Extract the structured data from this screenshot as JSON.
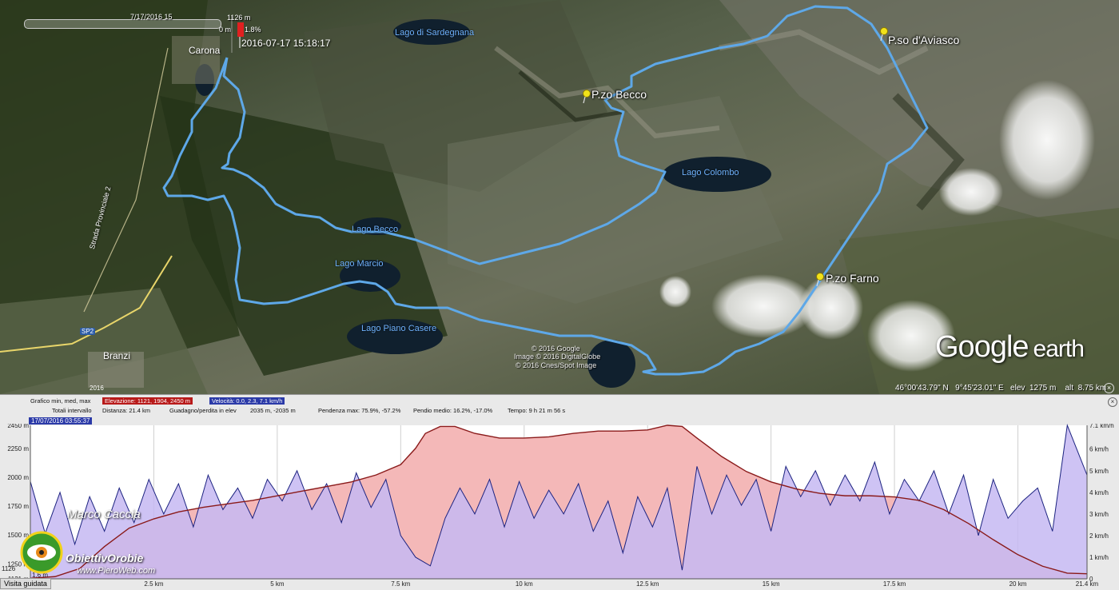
{
  "map": {
    "slider_date": "7/17/2016  15",
    "top_elev": "1126 m",
    "bottom_elev": "0 m",
    "grade": "1.8%",
    "marker_time": "2016-07-17 15:18:17",
    "town_carona": "Carona",
    "town_branzi": "Branzi",
    "road_label": "Strada Provinciale 2",
    "road_sp2": "SP2",
    "lakes": {
      "sardegnana": "Lago di Sardegnana",
      "colombo": "Lago Colombo",
      "becco": "Lago Becco",
      "marcio": "Lago Marcio",
      "piano_casere": "Lago Piano Casere"
    },
    "peaks": {
      "aviasco": "P.so d'Aviasco",
      "becco": "P.zo Becco",
      "farno": "P.zo Farno"
    },
    "copyright": [
      "© 2016 Google",
      "Image © 2016 DigitalGlobe",
      "© 2016 Cnes/Spot Image"
    ],
    "logo_google": "Google",
    "logo_earth": "earth",
    "status": {
      "lat": "46°00'43.79\" N",
      "lon": "9°45'23.01\" E",
      "elev_label": "elev",
      "elev": "1275 m",
      "alt_label": "alt",
      "alt": "8.75 km"
    },
    "year_badge": "2016",
    "colors": {
      "track": "#5ea8e8",
      "pin": "#f2e21a",
      "marker": "#e02020"
    }
  },
  "panel": {
    "row1": {
      "grafico": "Grafico  min, med, max",
      "elevazione": "Elevazione: 1121, 1904, 2450 m",
      "velocita": "Velocità: 0.0, 2.3, 7.1 km/h"
    },
    "row2": {
      "totali": "Totali intervallo",
      "distanza": "Distanza: 21.4 km",
      "guadagno_label": "Guadagno/perdita in elev",
      "guadagno": "2035 m, -2035 m",
      "pendenza": "Pendenza max: 75.9%, -57.2%",
      "pendio": "Pendio medio: 16.2%, -17.0%",
      "tempo": "Tempo: 9 h 21 m 56 s"
    },
    "date_badge": "17/07/2016 03:55:37",
    "cursor_elev": "1126",
    "cursor_speed": "1.6 m",
    "watermark_name": "Marco Caccia",
    "watermark_logo": "ObiettivOrobie",
    "watermark_url": "www.PieroWeb.com",
    "visita_button": "Visita guidata"
  },
  "chart_data": {
    "type": "area",
    "xlabel": "",
    "ylabel": "",
    "x_unit": "km",
    "xlim": [
      0,
      21.4
    ],
    "y_left_lim": [
      1121,
      2450
    ],
    "y_right_lim": [
      0,
      7.1
    ],
    "x_ticks": [
      "2.5 km",
      "5 km",
      "7.5 km",
      "10 km",
      "12.5 km",
      "15 km",
      "17.5 km",
      "20 km",
      "21.4 km"
    ],
    "y_left_ticks": [
      "1121 m",
      "1250 m",
      "1500 m",
      "1750 m",
      "2000 m",
      "2250 m",
      "2450 m"
    ],
    "y_right_ticks": [
      "0",
      "1 km/h",
      "2 km/h",
      "3 km/h",
      "4 km/h",
      "5 km/h",
      "6 km/h",
      "7.1 km/h"
    ],
    "series": [
      {
        "name": "Elevazione",
        "unit": "m",
        "color": "#8a1a1a",
        "fill": "#f4b8b8",
        "x": [
          0,
          0.5,
          1.0,
          1.5,
          2.0,
          2.5,
          3.0,
          3.5,
          4.0,
          4.5,
          5.0,
          5.5,
          6.0,
          6.5,
          7.0,
          7.5,
          7.8,
          8.0,
          8.3,
          8.6,
          9.0,
          9.5,
          10.0,
          10.5,
          11.0,
          11.5,
          12.0,
          12.5,
          12.9,
          13.2,
          13.5,
          14.0,
          14.5,
          15.0,
          15.5,
          16.0,
          16.5,
          17.0,
          17.5,
          18.0,
          18.5,
          19.0,
          19.5,
          20.0,
          20.5,
          21.0,
          21.4
        ],
        "y": [
          1126,
          1140,
          1210,
          1400,
          1560,
          1640,
          1700,
          1740,
          1770,
          1800,
          1840,
          1880,
          1920,
          1960,
          2020,
          2110,
          2250,
          2380,
          2440,
          2440,
          2380,
          2340,
          2340,
          2350,
          2380,
          2400,
          2400,
          2410,
          2450,
          2440,
          2340,
          2180,
          2050,
          1960,
          1900,
          1860,
          1840,
          1840,
          1830,
          1800,
          1720,
          1600,
          1460,
          1330,
          1230,
          1170,
          1165
        ]
      },
      {
        "name": "Velocità",
        "unit": "km/h",
        "color": "#1c2380",
        "fill": "#c6b8f2",
        "x": [
          0,
          0.3,
          0.6,
          0.9,
          1.2,
          1.5,
          1.8,
          2.1,
          2.4,
          2.7,
          3.0,
          3.3,
          3.6,
          3.9,
          4.2,
          4.5,
          4.8,
          5.1,
          5.4,
          5.7,
          6.0,
          6.3,
          6.6,
          6.9,
          7.2,
          7.5,
          7.8,
          8.1,
          8.4,
          8.7,
          9.0,
          9.3,
          9.6,
          9.9,
          10.2,
          10.5,
          10.8,
          11.1,
          11.4,
          11.7,
          12.0,
          12.3,
          12.6,
          12.9,
          13.2,
          13.5,
          13.8,
          14.1,
          14.4,
          14.7,
          15.0,
          15.3,
          15.6,
          15.9,
          16.2,
          16.5,
          16.8,
          17.1,
          17.4,
          17.7,
          18.0,
          18.3,
          18.6,
          18.9,
          19.2,
          19.5,
          19.8,
          20.1,
          20.4,
          20.7,
          21.0,
          21.4
        ],
        "y": [
          4.5,
          2.1,
          4.0,
          1.6,
          3.8,
          2.2,
          4.2,
          2.6,
          4.6,
          3.0,
          4.4,
          2.4,
          4.8,
          3.2,
          4.2,
          2.8,
          4.6,
          3.6,
          5.0,
          3.2,
          4.4,
          2.6,
          4.9,
          3.3,
          4.6,
          2.0,
          1.0,
          0.6,
          2.8,
          4.2,
          3.0,
          4.6,
          2.4,
          4.5,
          2.8,
          4.1,
          3.0,
          4.4,
          2.2,
          3.6,
          1.2,
          3.8,
          2.4,
          4.2,
          0.4,
          5.2,
          3.0,
          4.8,
          3.4,
          4.6,
          2.2,
          5.2,
          3.8,
          5.0,
          3.4,
          4.8,
          3.6,
          5.4,
          3.0,
          4.6,
          3.6,
          5.0,
          3.0,
          4.8,
          2.0,
          4.6,
          2.8,
          3.6,
          4.2,
          2.2,
          7.1,
          4.8
        ]
      }
    ]
  }
}
